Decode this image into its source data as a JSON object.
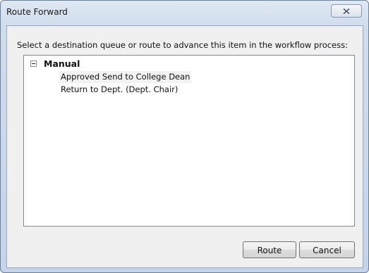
{
  "window": {
    "title": "Route Forward"
  },
  "prompt": "Select a destination queue or route to advance this item in the workflow process:",
  "tree": {
    "root_label": "Manual",
    "expanded": true,
    "items": [
      {
        "label": "Approved Send to College Dean",
        "selected": true
      },
      {
        "label": "Return to Dept. (Dept. Chair)",
        "selected": false
      }
    ]
  },
  "buttons": {
    "route": "Route",
    "cancel": "Cancel"
  },
  "icons": {
    "close": "close-icon",
    "collapse": "collapse-minus-icon"
  }
}
